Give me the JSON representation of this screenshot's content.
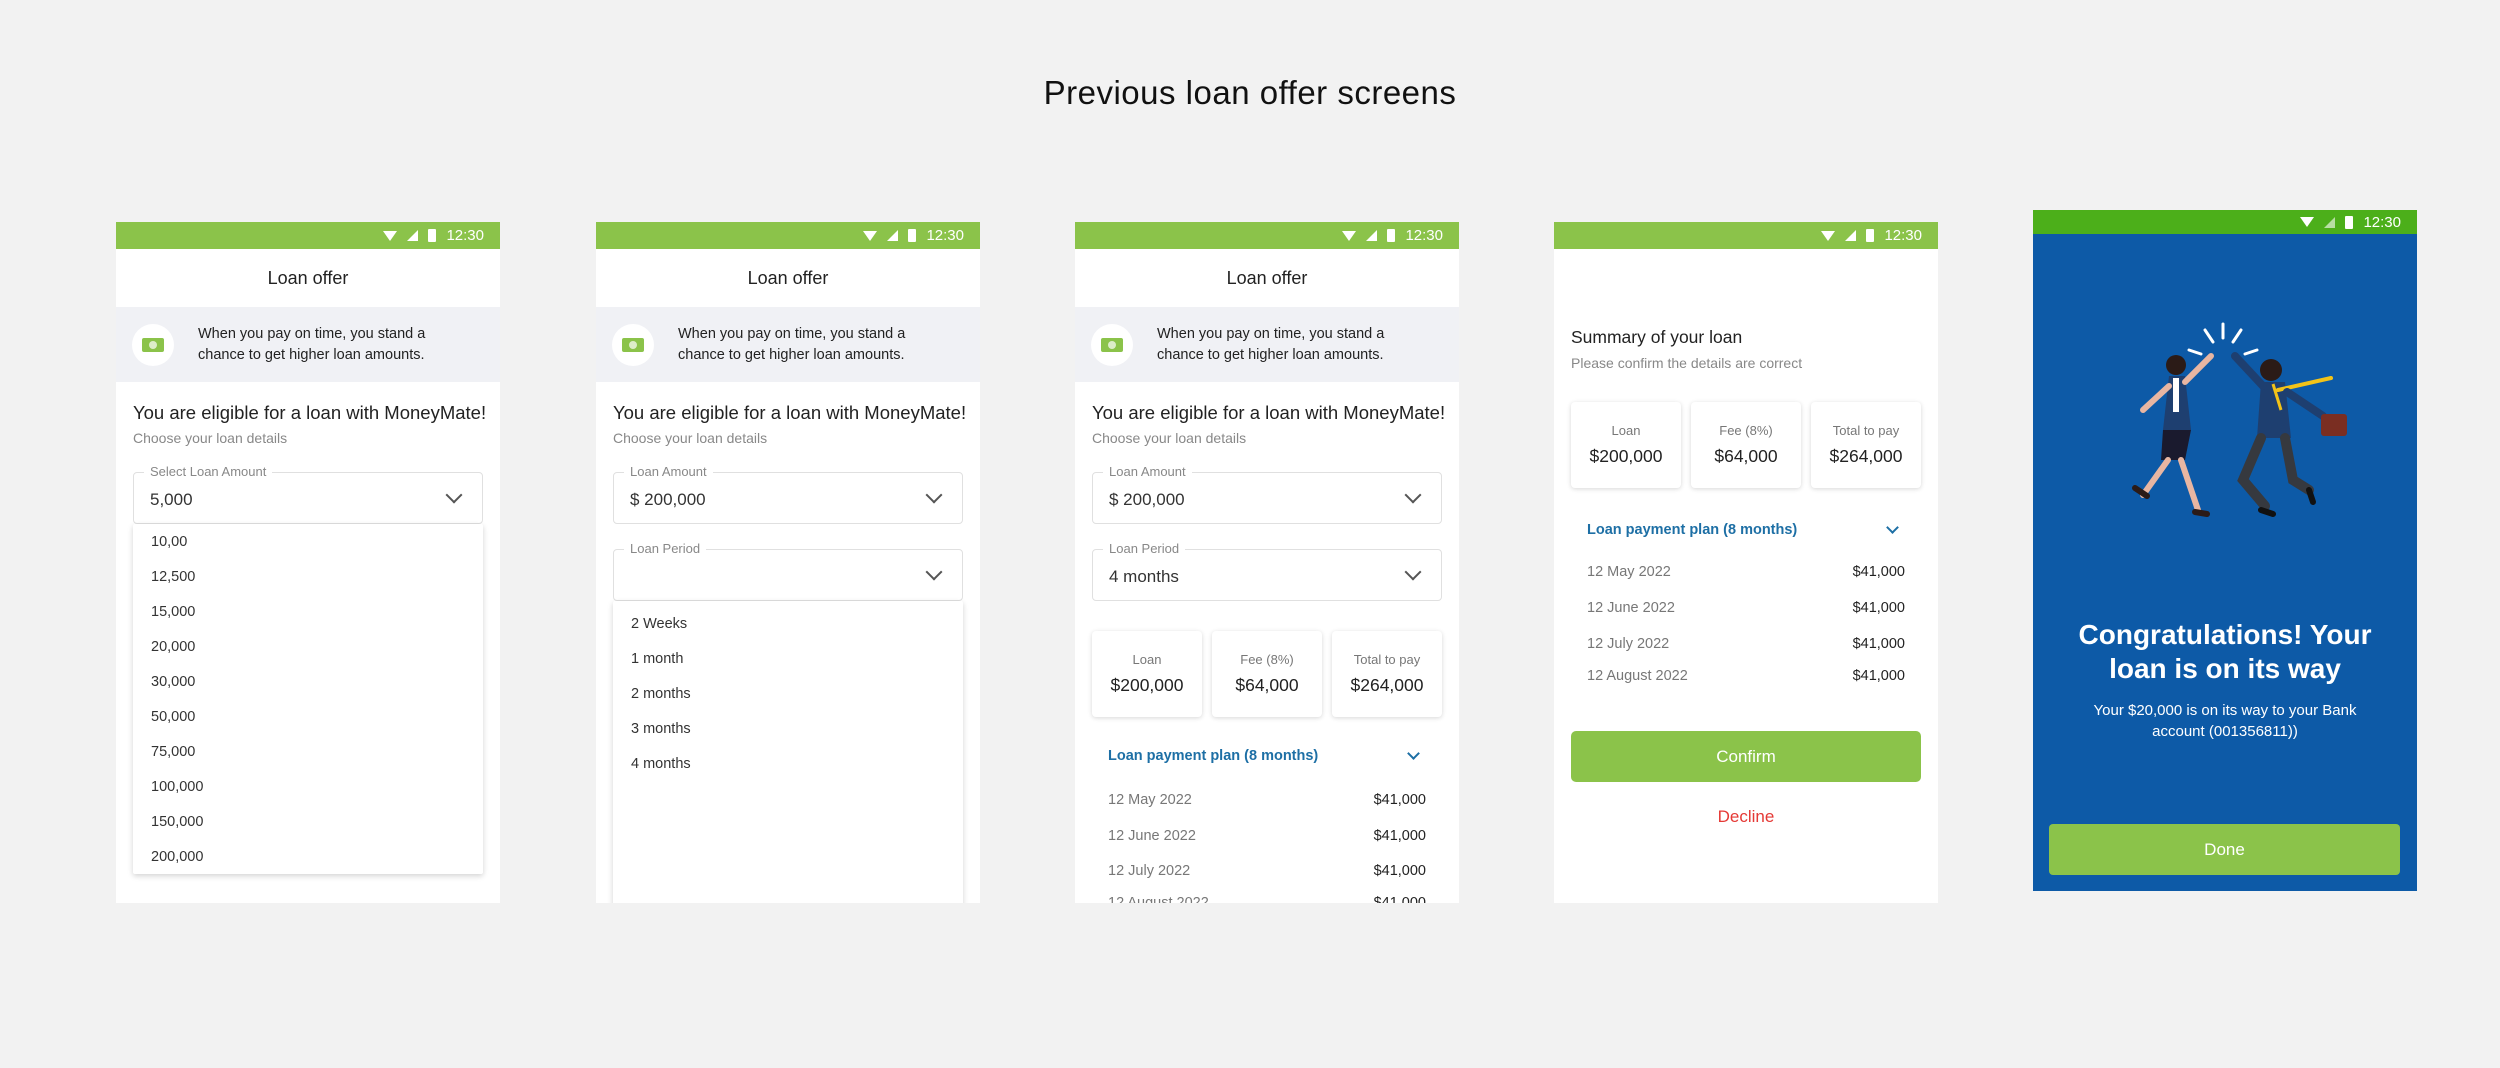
{
  "page": {
    "title": "Previous loan offer screens"
  },
  "colors": {
    "brand_green": "#8bc34a",
    "link_blue": "#1d6fa5",
    "decline_red": "#e53935",
    "success_blue": "#0d5aa7"
  },
  "status": {
    "time": "12:30"
  },
  "common": {
    "header_title": "Loan offer",
    "tip_text": "When you pay on time, you stand a chance to get higher loan amounts.",
    "eligible_title": "You are eligible for a loan with MoneyMate!",
    "eligible_sub": "Choose your loan details"
  },
  "screen1": {
    "amount_label": "Select Loan Amount",
    "amount_value": "5,000",
    "options": [
      "10,00",
      "12,500",
      "15,000",
      "20,000",
      "30,000",
      "50,000",
      "75,000",
      "100,000",
      "150,000",
      "200,000"
    ]
  },
  "screen2": {
    "amount_label": "Loan Amount",
    "amount_value": "$ 200,000",
    "period_label": "Loan Period",
    "period_value": "",
    "options": [
      "2 Weeks",
      "1 month",
      "2 months",
      "3 months",
      "4 months"
    ]
  },
  "screen3": {
    "amount_label": "Loan Amount",
    "amount_value": "$ 200,000",
    "period_label": "Loan Period",
    "period_value": "4 months"
  },
  "summary": {
    "title": "Summary of your loan",
    "subtitle": "Please confirm the details are correct",
    "cards": [
      {
        "label": "Loan",
        "value": "$200,000"
      },
      {
        "label": "Fee (8%)",
        "value": "$64,000"
      },
      {
        "label": "Total to pay",
        "value": "$264,000"
      }
    ],
    "plan_title": "Loan payment plan (8 months)",
    "payments": [
      {
        "date": "12 May 2022",
        "amount": "$41,000"
      },
      {
        "date": "12 June 2022",
        "amount": "$41,000"
      },
      {
        "date": "12 July 2022",
        "amount": "$41,000"
      },
      {
        "date": "12 August 2022",
        "amount": "$41,000"
      }
    ],
    "confirm_label": "Confirm",
    "decline_label": "Decline"
  },
  "success": {
    "title": "Congratulations! Your loan is on its way",
    "message": "Your $20,000 is on its way to your Bank account (001356811))",
    "done_label": "Done"
  }
}
